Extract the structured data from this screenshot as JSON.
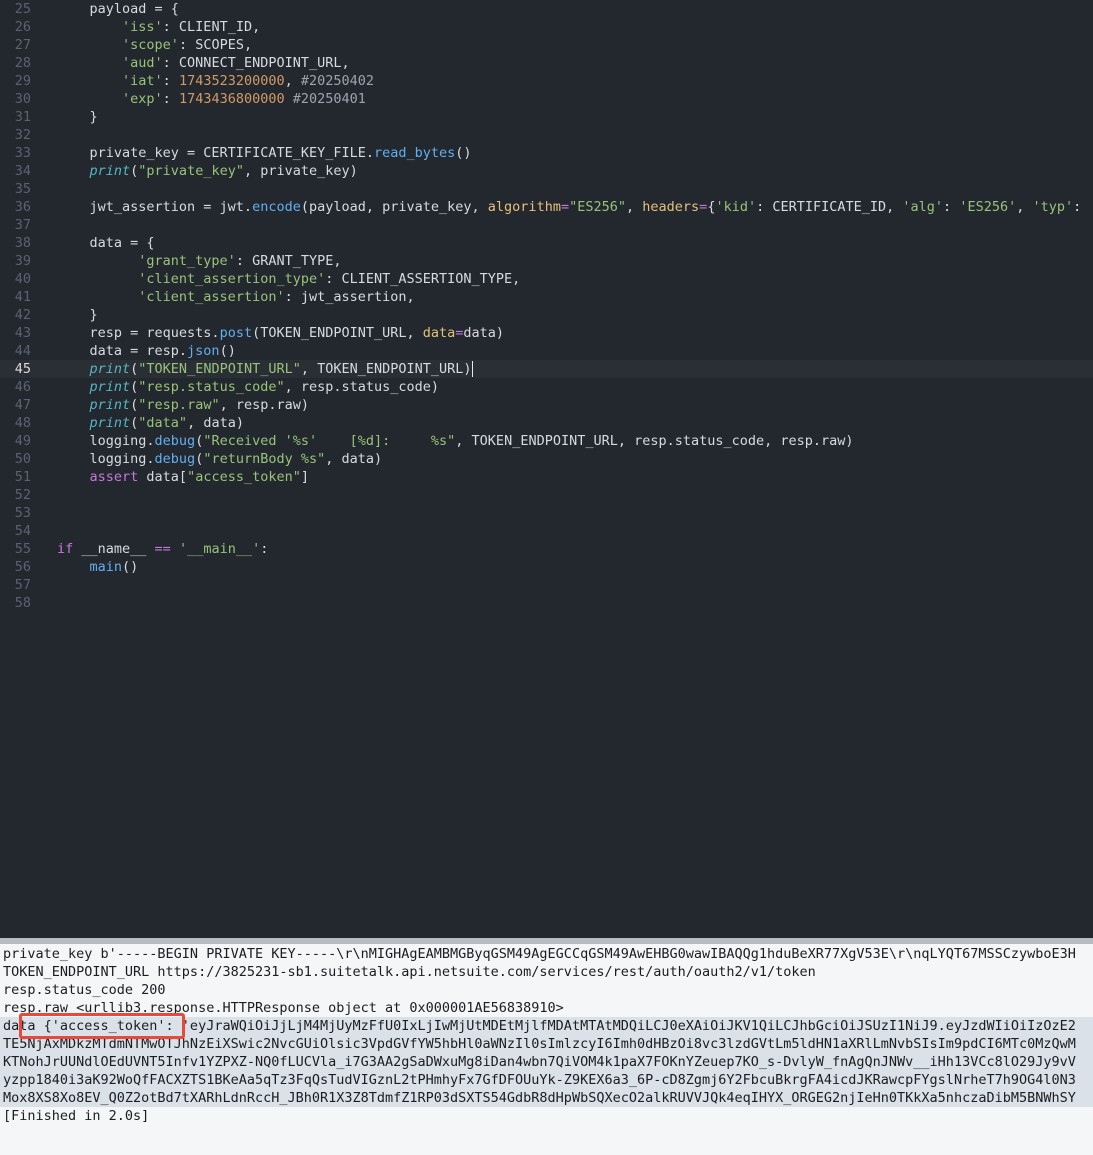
{
  "editor": {
    "current_line": "45",
    "lines": [
      {
        "no": "25",
        "tokens": [
          [
            "",
            "    payload = {"
          ]
        ]
      },
      {
        "no": "26",
        "tokens": [
          [
            "",
            "        "
          ],
          [
            "s",
            "'iss'"
          ],
          [
            "",
            ": CLIENT_ID,"
          ]
        ]
      },
      {
        "no": "27",
        "tokens": [
          [
            "",
            "        "
          ],
          [
            "s",
            "'scope'"
          ],
          [
            "",
            ": SCOPES,"
          ]
        ]
      },
      {
        "no": "28",
        "tokens": [
          [
            "",
            "        "
          ],
          [
            "s",
            "'aud'"
          ],
          [
            "",
            ": CONNECT_ENDPOINT_URL,"
          ]
        ]
      },
      {
        "no": "29",
        "tokens": [
          [
            "",
            "        "
          ],
          [
            "s",
            "'iat'"
          ],
          [
            "",
            ": "
          ],
          [
            "n",
            "1743523200000"
          ],
          [
            "",
            ", "
          ],
          [
            "c",
            "#20250402"
          ]
        ]
      },
      {
        "no": "30",
        "tokens": [
          [
            "",
            "        "
          ],
          [
            "s",
            "'exp'"
          ],
          [
            "",
            ": "
          ],
          [
            "n",
            "1743436800000"
          ],
          [
            "c",
            " #20250401"
          ]
        ]
      },
      {
        "no": "31",
        "tokens": [
          [
            "",
            "    }"
          ]
        ]
      },
      {
        "no": "32",
        "tokens": []
      },
      {
        "no": "33",
        "tokens": [
          [
            "",
            "    private_key = CERTIFICATE_KEY_FILE."
          ],
          [
            "f",
            "read_bytes"
          ],
          [
            "",
            "()"
          ]
        ]
      },
      {
        "no": "34",
        "tokens": [
          [
            "",
            "    "
          ],
          [
            "b",
            "print"
          ],
          [
            "",
            "("
          ],
          [
            "s",
            "\"private_key\""
          ],
          [
            "",
            ", private_key)"
          ]
        ]
      },
      {
        "no": "35",
        "tokens": []
      },
      {
        "no": "36",
        "tokens": [
          [
            "",
            "    jwt_assertion = jwt."
          ],
          [
            "f",
            "encode"
          ],
          [
            "",
            "(payload, private_key, "
          ],
          [
            "p",
            "algorithm"
          ],
          [
            "op",
            "="
          ],
          [
            "s",
            "\"ES256\""
          ],
          [
            "",
            ", "
          ],
          [
            "p",
            "headers"
          ],
          [
            "op",
            "="
          ],
          [
            "",
            "{"
          ],
          [
            "s",
            "'kid'"
          ],
          [
            "",
            ": CERTIFICATE_ID, "
          ],
          [
            "s",
            "'alg'"
          ],
          [
            "",
            ": "
          ],
          [
            "s",
            "'ES256'"
          ],
          [
            "",
            ", "
          ],
          [
            "s",
            "'typ'"
          ],
          [
            "",
            ":"
          ]
        ]
      },
      {
        "no": "37",
        "tokens": []
      },
      {
        "no": "38",
        "tokens": [
          [
            "",
            "    data = {"
          ]
        ]
      },
      {
        "no": "39",
        "tokens": [
          [
            "",
            "          "
          ],
          [
            "s",
            "'grant_type'"
          ],
          [
            "",
            ": GRANT_TYPE,"
          ]
        ]
      },
      {
        "no": "40",
        "tokens": [
          [
            "",
            "          "
          ],
          [
            "s",
            "'client_assertion_type'"
          ],
          [
            "",
            ": CLIENT_ASSERTION_TYPE,"
          ]
        ]
      },
      {
        "no": "41",
        "tokens": [
          [
            "",
            "          "
          ],
          [
            "s",
            "'client_assertion'"
          ],
          [
            "",
            ": jwt_assertion,"
          ]
        ]
      },
      {
        "no": "42",
        "tokens": [
          [
            "",
            "    }"
          ]
        ]
      },
      {
        "no": "43",
        "tokens": [
          [
            "",
            "    resp = requests."
          ],
          [
            "f",
            "post"
          ],
          [
            "",
            "(TOKEN_ENDPOINT_URL, "
          ],
          [
            "p",
            "data"
          ],
          [
            "op",
            "="
          ],
          [
            "",
            "data)"
          ]
        ]
      },
      {
        "no": "44",
        "tokens": [
          [
            "",
            "    data = resp."
          ],
          [
            "f",
            "json"
          ],
          [
            "",
            "()"
          ]
        ]
      },
      {
        "no": "45",
        "tokens": [
          [
            "",
            "    "
          ],
          [
            "b",
            "print"
          ],
          [
            "",
            "("
          ],
          [
            "s",
            "\"TOKEN_ENDPOINT_URL\""
          ],
          [
            "",
            ", TOKEN_ENDPOINT_URL)"
          ]
        ]
      },
      {
        "no": "46",
        "tokens": [
          [
            "",
            "    "
          ],
          [
            "b",
            "print"
          ],
          [
            "",
            "("
          ],
          [
            "s",
            "\"resp.status_code\""
          ],
          [
            "",
            ", resp.status_code)"
          ]
        ]
      },
      {
        "no": "47",
        "tokens": [
          [
            "",
            "    "
          ],
          [
            "b",
            "print"
          ],
          [
            "",
            "("
          ],
          [
            "s",
            "\"resp.raw\""
          ],
          [
            "",
            ", resp.raw)"
          ]
        ]
      },
      {
        "no": "48",
        "tokens": [
          [
            "",
            "    "
          ],
          [
            "b",
            "print"
          ],
          [
            "",
            "("
          ],
          [
            "s",
            "\"data\""
          ],
          [
            "",
            ", data)"
          ]
        ]
      },
      {
        "no": "49",
        "tokens": [
          [
            "",
            "    logging."
          ],
          [
            "f",
            "debug"
          ],
          [
            "",
            "("
          ],
          [
            "s",
            "\"Received '%s'    [%d]:     %s\""
          ],
          [
            "",
            ", TOKEN_ENDPOINT_URL, resp.status_code, resp.raw)"
          ]
        ]
      },
      {
        "no": "50",
        "tokens": [
          [
            "",
            "    logging."
          ],
          [
            "f",
            "debug"
          ],
          [
            "",
            "("
          ],
          [
            "s",
            "\"returnBody %s\""
          ],
          [
            "",
            ", data)"
          ]
        ]
      },
      {
        "no": "51",
        "tokens": [
          [
            "",
            "    "
          ],
          [
            "k",
            "assert"
          ],
          [
            "",
            ""
          ],
          [
            "",
            ""
          ],
          [
            "",
            " data["
          ],
          [
            "s",
            "\"access_token\""
          ],
          [
            "",
            "]"
          ]
        ]
      },
      {
        "no": "52",
        "tokens": []
      },
      {
        "no": "53",
        "tokens": []
      },
      {
        "no": "54",
        "tokens": []
      },
      {
        "no": "55",
        "tokens": [
          [
            "k",
            "if"
          ],
          [
            "",
            " __name__ "
          ],
          [
            "op",
            "=="
          ],
          [
            "",
            ""
          ],
          [
            "s",
            " '__main__'"
          ],
          [
            "",
            ":"
          ]
        ]
      },
      {
        "no": "56",
        "tokens": [
          [
            "",
            "    "
          ],
          [
            "f",
            "main"
          ],
          [
            "",
            "()"
          ]
        ]
      },
      {
        "no": "57",
        "tokens": []
      },
      {
        "no": "58",
        "tokens": []
      }
    ]
  },
  "console": {
    "lines": [
      "private_key b'-----BEGIN PRIVATE KEY-----\\r\\nMIGHAgEAMBMGByqGSM49AgEGCCqGSM49AwEHBG0wawIBAQQg1hduBeXR77XgV53E\\r\\nqLYQT67MSSCzywboE3H",
      "TOKEN_ENDPOINT_URL https://3825231-sb1.suitetalk.api.netsuite.com/services/rest/auth/oauth2/v1/token",
      "resp.status_code 200",
      "resp.raw <urllib3.response.HTTPResponse object at 0x000001AE56838910>",
      "data {'access_token': 'eyJraWQiOiJjLjM4MjUyMzFfU0IxLjIwMjUtMDEtMjlfMDAtMTAtMDQiLCJ0eXAiOiJKV1QiLCJhbGciOiJSUzI1NiJ9.eyJzdWIiOiIzOzE2",
      "TE5NjAxMDkzMTdmNTMwOTJhNzEiXSwic2NvcGUiOlsic3VpdGVfYW5hbHl0aWNzIl0sImlzcyI6Imh0dHBzOi8vc3lzdGVtLm5ldHN1aXRlLmNvbSIsIm9pdCI6MTc0MzQwM",
      "KTNohJrUUNdlOEdUVNT5Infv1YZPXZ-NQ0fLUCVla_i7G3AA2gSaDWxuMg8iDan4wbn7QiVOM4k1paX7FOKnYZeuep7KO_s-DvlyW_fnAgQnJNWv__iHh13VCc8lO29Jy9vV",
      "yzpp1840i3aK92WoQfFACXZTS1BKeAa5qTz3FqQsTudVIGznL2tPHmhyFx7GfDFOUuYk-Z9KEX6a3_6P-cD8Zgmj6Y2FbcuBkrgFA4icdJKRawcpFYgslNrheT7h9OG4l0N3",
      "Mox8XS8Xo8EV_Q0Z2otBd7tXARhLdnRccH_JBh0R1X3Z8TdmfZ1RP03dSXTS54GdbR8dHpWbSQXecO2alkRUVVJQk4eqIHYX_ORGEG2njIeHn0TKkXa5nhczaDibM5BNWhSY",
      "[Finished in 2.0s]"
    ]
  }
}
